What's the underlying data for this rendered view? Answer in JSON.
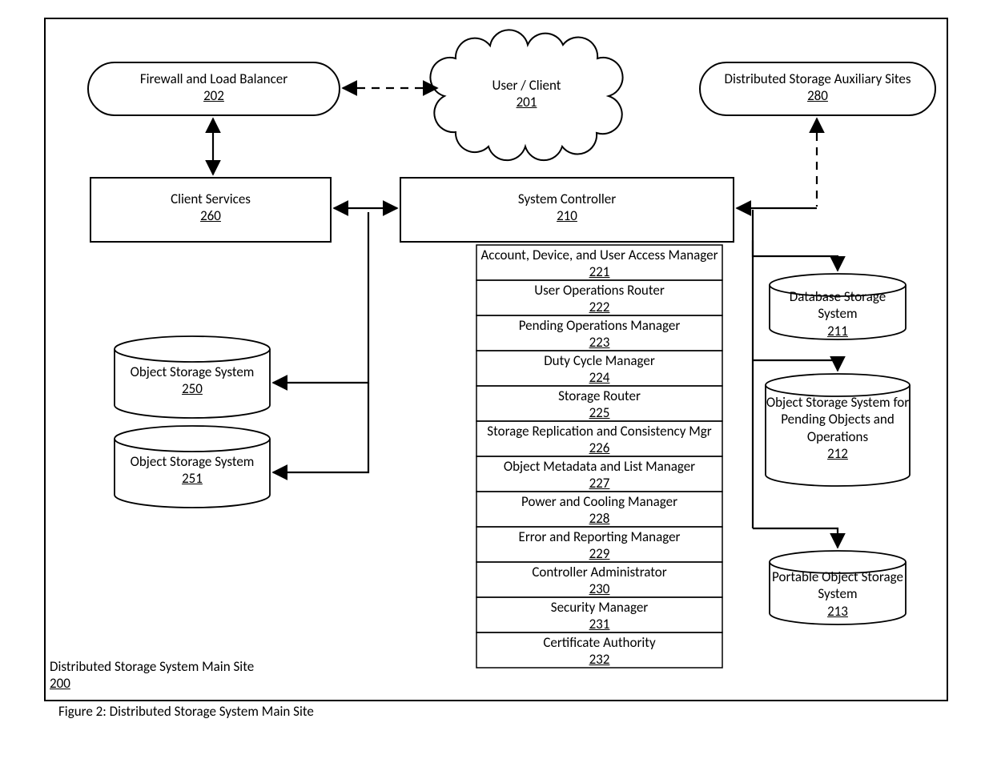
{
  "caption": "Figure 2: Distributed Storage System Main Site",
  "site": {
    "label": "Distributed Storage System Main Site",
    "ref": "200"
  },
  "nodes": {
    "firewall": {
      "label": "Firewall and Load Balancer",
      "ref": "202"
    },
    "userClient": {
      "label": "User / Client",
      "ref": "201"
    },
    "auxSites": {
      "label": "Distributed Storage Auxiliary Sites",
      "ref": "280"
    },
    "clientServices": {
      "label": "Client Services",
      "ref": "260"
    },
    "systemController": {
      "label": "System Controller",
      "ref": "210"
    },
    "oss250": {
      "label": "Object Storage System",
      "ref": "250"
    },
    "oss251": {
      "label": "Object Storage System",
      "ref": "251"
    },
    "dbStorage": {
      "label": "Database Storage System",
      "ref": "211"
    },
    "pendingStorage": {
      "label": "Object Storage System for Pending Objects and Operations",
      "ref": "212"
    },
    "portableStorage": {
      "label": "Portable Object Storage System",
      "ref": "213"
    }
  },
  "controllerModules": [
    {
      "label": "Account, Device, and User Access Manager",
      "ref": "221"
    },
    {
      "label": "User Operations Router",
      "ref": "222"
    },
    {
      "label": "Pending Operations Manager",
      "ref": "223"
    },
    {
      "label": "Duty Cycle Manager",
      "ref": "224"
    },
    {
      "label": "Storage Router",
      "ref": "225"
    },
    {
      "label": "Storage Replication and Consistency Mgr",
      "ref": "226"
    },
    {
      "label": "Object Metadata and List Manager",
      "ref": "227"
    },
    {
      "label": "Power and Cooling Manager",
      "ref": "228"
    },
    {
      "label": "Error and Reporting Manager",
      "ref": "229"
    },
    {
      "label": "Controller Administrator",
      "ref": "230"
    },
    {
      "label": "Security Manager",
      "ref": "231"
    },
    {
      "label": "Certificate Authority",
      "ref": "232"
    }
  ]
}
